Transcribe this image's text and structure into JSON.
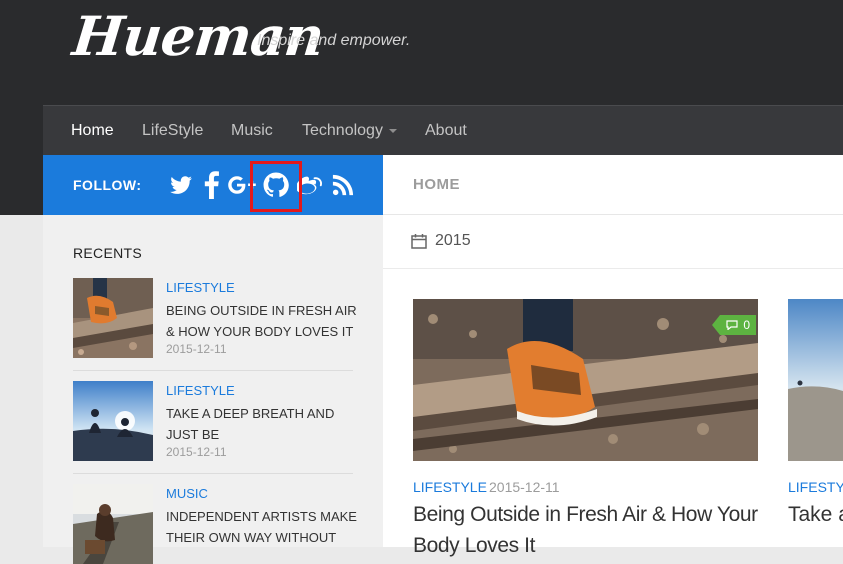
{
  "header": {
    "logo_text": "Hueman",
    "tagline": "Inspire and empower."
  },
  "nav": {
    "items": [
      {
        "label": "Home",
        "active": true
      },
      {
        "label": "LifeStyle"
      },
      {
        "label": "Music"
      },
      {
        "label": "Technology",
        "has_dropdown": true
      },
      {
        "label": "About"
      }
    ]
  },
  "follow": {
    "label": "FOLLOW:",
    "icons": [
      "twitter-icon",
      "facebook-icon",
      "google-plus-icon",
      "github-icon",
      "weibo-icon",
      "rss-icon"
    ],
    "highlighted_icon": "github-icon"
  },
  "sidebar": {
    "title": "RECENTS",
    "posts": [
      {
        "category": "LIFESTYLE",
        "title": "BEING OUTSIDE IN FRESH AIR & HOW YOUR BODY LOVES IT",
        "date": "2015-12-11"
      },
      {
        "category": "LIFESTYLE",
        "title": "TAKE A DEEP BREATH AND JUST BE",
        "date": "2015-12-11"
      },
      {
        "category": "MUSIC",
        "title": "INDEPENDENT ARTISTS MAKE THEIR OWN WAY WITHOUT",
        "date": ""
      }
    ]
  },
  "main": {
    "breadcrumb": "HOME",
    "year": "2015",
    "featured": [
      {
        "category": "LIFESTYLE",
        "date": "2015-12-11",
        "title": "Being Outside in Fresh Air & How Your Body Loves It",
        "comments": "0"
      },
      {
        "category": "LIFESTYLE",
        "title": "Take a Deep Breath and Just Be"
      }
    ]
  },
  "colors": {
    "accent": "#1b7bdc",
    "header_bg": "#2a2b2d",
    "nav_bg": "#38393c",
    "comment_badge": "#5db341",
    "highlight": "#e3191b"
  }
}
